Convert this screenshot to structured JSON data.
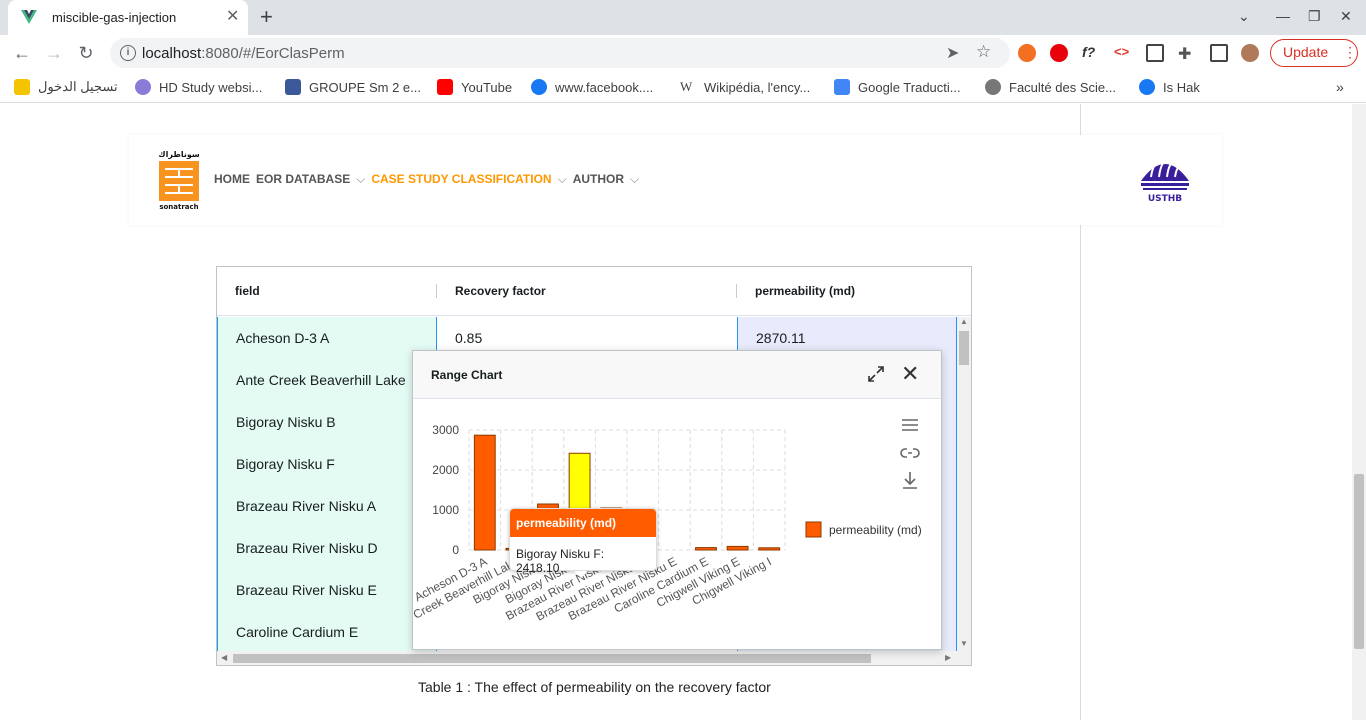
{
  "browser": {
    "tab_title": "miscible-gas-injection",
    "url_host": "localhost",
    "url_rest": ":8080/#/EorClasPerm",
    "update_label": "Update"
  },
  "bookmarks": [
    "تسجيل الدخول",
    "HD Study websi...",
    "GROUPE Sm 2 e...",
    "YouTube",
    "www.facebook....",
    "Wikipédia, l'ency...",
    "Google Traducti...",
    "Faculté des Scie...",
    "Is Hak"
  ],
  "header": {
    "nav": [
      "HOME",
      "EOR DATABASE",
      "CASE STUDY CLASSIFICATION",
      "AUTHOR"
    ],
    "logo_left_text": "sonatrach",
    "logo_right_text": "USTHB"
  },
  "grid": {
    "columns": [
      "field",
      "Recovery factor",
      "permeability (md)"
    ],
    "rows": [
      [
        "Acheson D-3 A",
        "0.85",
        "2870.11"
      ],
      [
        "Ante Creek Beaverhill Lake",
        "",
        ""
      ],
      [
        "Bigoray Nisku B",
        "",
        ""
      ],
      [
        "Bigoray Nisku F",
        "",
        ""
      ],
      [
        "Brazeau River Nisku A",
        "",
        ""
      ],
      [
        "Brazeau River Nisku D",
        "",
        ""
      ],
      [
        "Brazeau River Nisku E",
        "",
        ""
      ],
      [
        "Caroline Cardium E",
        "",
        ""
      ]
    ]
  },
  "caption": "Table 1 : The effect of permeability on the recovery factor",
  "dialog": {
    "title": "Range Chart",
    "tooltip_title": "permeability (md)",
    "tooltip_text": "Bigoray Nisku F: 2418.10"
  },
  "chart_data": {
    "type": "bar",
    "categories": [
      "Acheson D-3 A",
      "Ante Creek Beaverhill Lake",
      "Bigoray Nisku B",
      "Bigoray Nisku F",
      "Brazeau River Nisku A",
      "Brazeau River Nisku D",
      "Brazeau River Nisku E",
      "Caroline Cardium E",
      "Chigwell Viking E",
      "Chigwell Viking I"
    ],
    "series": [
      {
        "name": "permeability (md)",
        "values": [
          2870.11,
          40,
          1150,
          2418.1,
          1050,
          0,
          0,
          60,
          90,
          55
        ],
        "color": "#ff5c00"
      }
    ],
    "highlight_index": 3,
    "highlight_color": "#ffff00",
    "yticks": [
      0,
      1000,
      2000,
      3000
    ],
    "ylim": [
      0,
      3000
    ],
    "legend_position": "right"
  }
}
